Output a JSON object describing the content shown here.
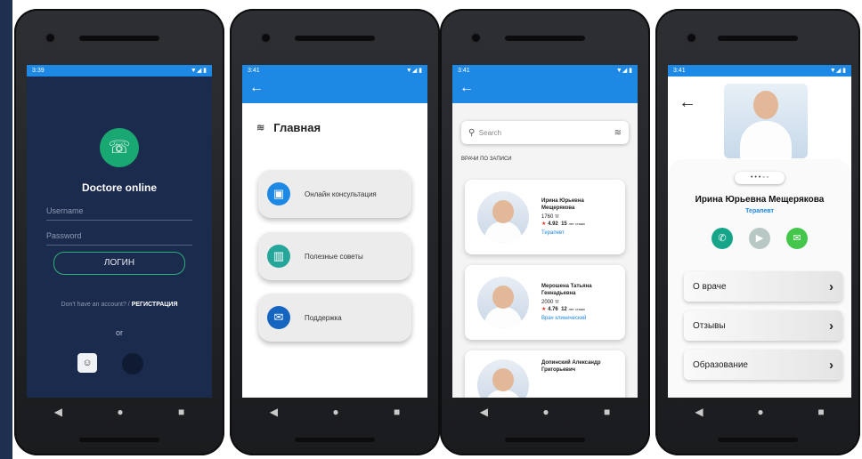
{
  "phone1": {
    "status_time": "3:39",
    "status_icons": "▼◢ ▮",
    "brand": "Doctore online",
    "username_placeholder": "Username",
    "password_placeholder": "Password",
    "login_label": "ЛОГИН",
    "signup_prompt": "Don't have an account? /",
    "signup_link": "РЕГИСТРАЦИЯ",
    "or": "or"
  },
  "phone2": {
    "status_time": "3:41",
    "status_icons": "▼◢ ▮",
    "back": "←",
    "title": "Главная",
    "cards": [
      {
        "label": "Онлайн консультация",
        "icon": "computer-icon",
        "color": "#1e88e5"
      },
      {
        "label": "Полезные советы",
        "icon": "chart-icon",
        "color": "#26a69a"
      },
      {
        "label": "Поддержка",
        "icon": "support-icon",
        "color": "#1565c0"
      }
    ]
  },
  "phone3": {
    "status_time": "3:41",
    "status_icons": "▼◢ ▮",
    "back": "←",
    "search_placeholder": "Search",
    "section": "ВРАЧИ ПО ЗАПИСИ",
    "doctors": [
      {
        "name": "Ирина Юрьевна Мещерякова",
        "price": "1760 тг",
        "rating": "4.92",
        "years": "15",
        "years_label": "лет стажа",
        "role": "Терапевт"
      },
      {
        "name": "Мерошена Татьяна Геннадьевна",
        "price": "2000 тг",
        "rating": "4.76",
        "years": "12",
        "years_label": "лет стажа",
        "role": "Врач клинический"
      },
      {
        "name": "Допинский Александр Григорьевич",
        "price": "",
        "rating": "",
        "years": "",
        "years_label": "",
        "role": ""
      }
    ]
  },
  "phone4": {
    "status_time": "3:41",
    "status_icons": "▼◢ ▮",
    "back": "←",
    "dots": "• • • ◦ ◦",
    "name": "Ирина Юрьевна Мещерякова",
    "role": "Терапевт",
    "rows": [
      "О враче",
      "Отзывы",
      "Образование"
    ],
    "chevron": "›"
  },
  "nav": {
    "back": "◀",
    "home": "●",
    "recents": "■"
  }
}
